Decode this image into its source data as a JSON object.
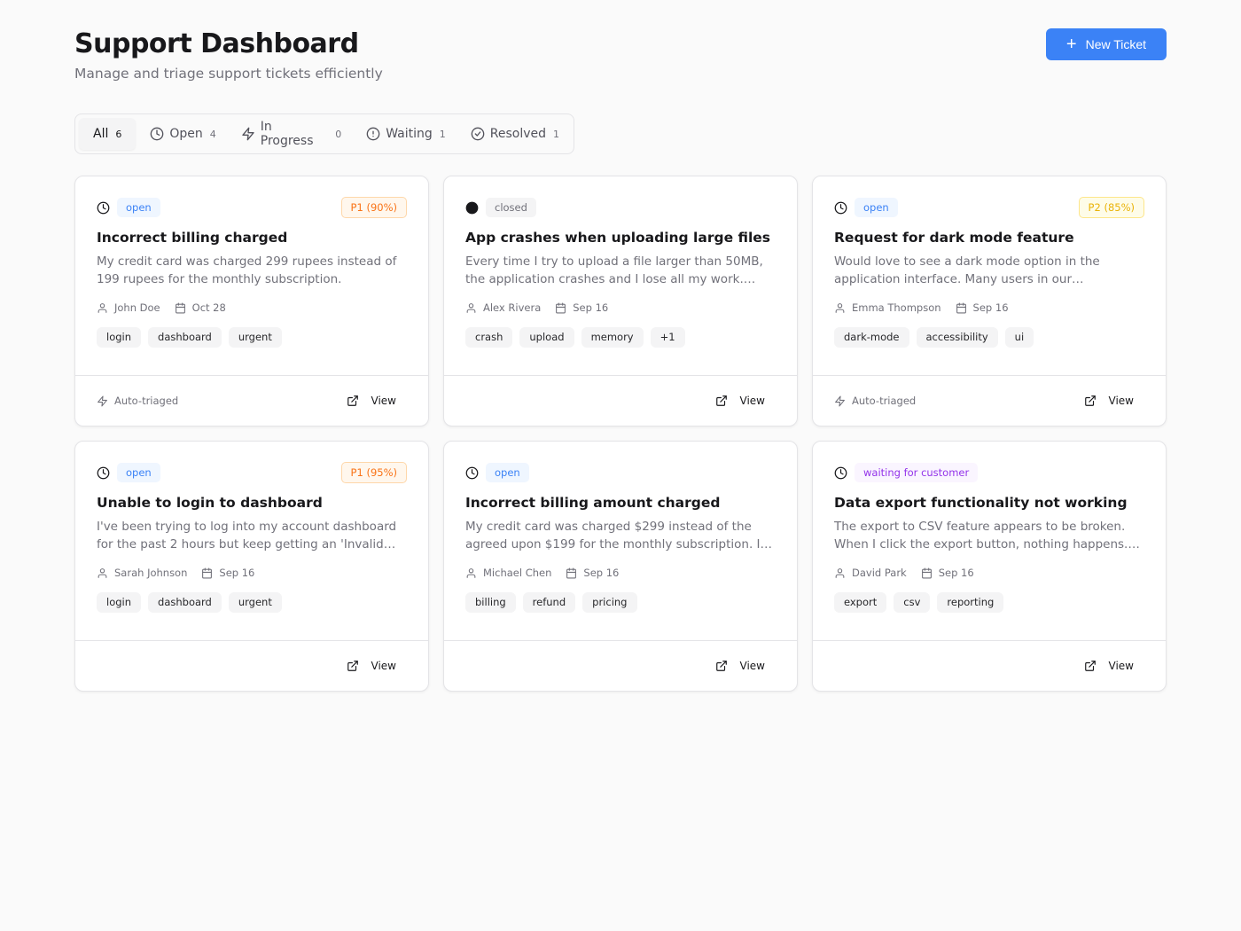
{
  "header": {
    "title": "Support Dashboard",
    "subtitle": "Manage and triage support tickets efficiently",
    "new_ticket_label": "New Ticket"
  },
  "tabs": [
    {
      "label": "All",
      "count": "6",
      "icon": "none",
      "active": true
    },
    {
      "label": "Open",
      "count": "4",
      "icon": "clock-icon"
    },
    {
      "label": "In Progress",
      "count": "0",
      "icon": "lightning-icon"
    },
    {
      "label": "Waiting",
      "count": "1",
      "icon": "alert-circle-icon"
    },
    {
      "label": "Resolved",
      "count": "1",
      "icon": "check-circle-icon"
    }
  ],
  "tickets": [
    {
      "status": "open",
      "status_icon": "clock-icon",
      "priority": "P1 (90%)",
      "priority_level": "p1",
      "title": "Incorrect billing charged",
      "description": "My credit card was charged 299 rupees instead of 199 rupees for the monthly subscription.",
      "author": "John Doe",
      "date": "Oct 28",
      "tags": [
        "login",
        "dashboard",
        "urgent"
      ],
      "auto_triaged": "Auto-triaged",
      "view_label": "View"
    },
    {
      "status": "closed",
      "status_icon": "filled-circle-icon",
      "priority": "",
      "priority_level": "",
      "title": "App crashes when uploading large files",
      "description": "Every time I try to upload a file larger than 50MB, the application crashes and I lose all my work. This…",
      "author": "Alex Rivera",
      "date": "Sep 16",
      "tags": [
        "crash",
        "upload",
        "memory",
        "+1"
      ],
      "auto_triaged": "",
      "view_label": "View"
    },
    {
      "status": "open",
      "status_icon": "clock-icon",
      "priority": "P2 (85%)",
      "priority_level": "p2",
      "title": "Request for dark mode feature",
      "description": "Would love to see a dark mode option in the application interface. Many users in our organizatio…",
      "author": "Emma Thompson",
      "date": "Sep 16",
      "tags": [
        "dark-mode",
        "accessibility",
        "ui"
      ],
      "auto_triaged": "Auto-triaged",
      "view_label": "View"
    },
    {
      "status": "open",
      "status_icon": "clock-icon",
      "priority": "P1 (95%)",
      "priority_level": "p1",
      "title": "Unable to login to dashboard",
      "description": "I've been trying to log into my account dashboard for the past 2 hours but keep getting an 'Invalid…",
      "author": "Sarah Johnson",
      "date": "Sep 16",
      "tags": [
        "login",
        "dashboard",
        "urgent"
      ],
      "auto_triaged": "",
      "view_label": "View"
    },
    {
      "status": "open",
      "status_icon": "clock-icon",
      "priority": "",
      "priority_level": "",
      "title": "Incorrect billing amount charged",
      "description": "My credit card was charged $299 instead of the agreed upon $199 for the monthly subscription. I…",
      "author": "Michael Chen",
      "date": "Sep 16",
      "tags": [
        "billing",
        "refund",
        "pricing"
      ],
      "auto_triaged": "",
      "view_label": "View"
    },
    {
      "status": "waiting for customer",
      "status_icon": "clock-icon",
      "priority": "",
      "priority_level": "",
      "title": "Data export functionality not working",
      "description": "The export to CSV feature appears to be broken. When I click the export button, nothing happens. N…",
      "author": "David Park",
      "date": "Sep 16",
      "tags": [
        "export",
        "csv",
        "reporting"
      ],
      "auto_triaged": "",
      "view_label": "View"
    }
  ],
  "colors": {
    "accent": "#3b82f6",
    "open": "#3b82f6",
    "waiting": "#9333ea",
    "p1": "#f97316",
    "p2": "#eab308"
  }
}
